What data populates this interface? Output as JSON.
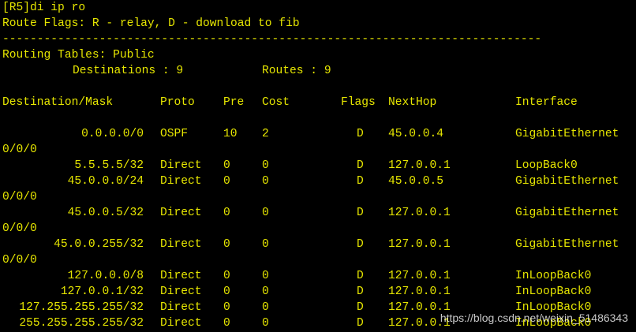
{
  "colors": {
    "background": "#000000",
    "text": "#e6e600"
  },
  "terminal": {
    "command": "[R5]di ip ro",
    "route_flags": "Route Flags: R - relay, D - download to fib",
    "separator": "------------------------------------------------------------------------------",
    "routing_tables": "Routing Tables: Public",
    "destinations_label": "Destinations : 9",
    "routes_label": "Routes : 9",
    "headers": {
      "destination": "Destination/Mask",
      "proto": "Proto",
      "pre": "Pre",
      "cost": "Cost",
      "flags": "Flags",
      "nexthop": "NextHop",
      "interface": "Interface"
    },
    "routes": [
      {
        "destination": "0.0.0.0/0",
        "proto": "OSPF",
        "pre": "10",
        "cost": "2",
        "flags": "D",
        "nexthop": "45.0.0.4",
        "interface": "GigabitEthernet",
        "cont": "0/0/0"
      },
      {
        "destination": "5.5.5.5/32",
        "proto": "Direct",
        "pre": "0",
        "cost": "0",
        "flags": "D",
        "nexthop": "127.0.0.1",
        "interface": "LoopBack0",
        "cont": ""
      },
      {
        "destination": "45.0.0.0/24",
        "proto": "Direct",
        "pre": "0",
        "cost": "0",
        "flags": "D",
        "nexthop": "45.0.0.5",
        "interface": "GigabitEthernet",
        "cont": "0/0/0"
      },
      {
        "destination": "45.0.0.5/32",
        "proto": "Direct",
        "pre": "0",
        "cost": "0",
        "flags": "D",
        "nexthop": "127.0.0.1",
        "interface": "GigabitEthernet",
        "cont": "0/0/0"
      },
      {
        "destination": "45.0.0.255/32",
        "proto": "Direct",
        "pre": "0",
        "cost": "0",
        "flags": "D",
        "nexthop": "127.0.0.1",
        "interface": "GigabitEthernet",
        "cont": "0/0/0"
      },
      {
        "destination": "127.0.0.0/8",
        "proto": "Direct",
        "pre": "0",
        "cost": "0",
        "flags": "D",
        "nexthop": "127.0.0.1",
        "interface": "InLoopBack0",
        "cont": ""
      },
      {
        "destination": "127.0.0.1/32",
        "proto": "Direct",
        "pre": "0",
        "cost": "0",
        "flags": "D",
        "nexthop": "127.0.0.1",
        "interface": "InLoopBack0",
        "cont": ""
      },
      {
        "destination": "127.255.255.255/32",
        "proto": "Direct",
        "pre": "0",
        "cost": "0",
        "flags": "D",
        "nexthop": "127.0.0.1",
        "interface": "InLoopBack0",
        "cont": ""
      },
      {
        "destination": "255.255.255.255/32",
        "proto": "Direct",
        "pre": "0",
        "cost": "0",
        "flags": "D",
        "nexthop": "127.0.0.1",
        "interface": "InLoopBack0",
        "cont": ""
      }
    ]
  },
  "watermark": "https://blog.csdn.net/weixin_51486343"
}
